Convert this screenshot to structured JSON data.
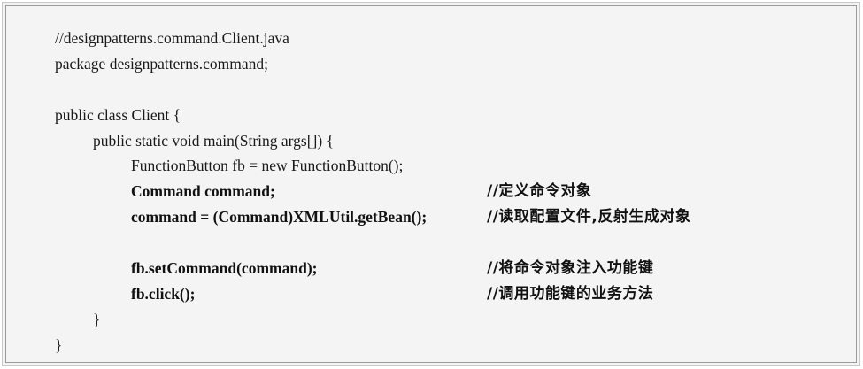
{
  "code": {
    "lines": [
      {
        "text": "//designpatterns.command.Client.java",
        "comment": ""
      },
      {
        "text": "package designpatterns.command;",
        "comment": ""
      },
      {
        "text": "",
        "comment": ""
      },
      {
        "text": "public class Client {",
        "comment": ""
      },
      {
        "text": "public static void main(String args[]) {",
        "comment": ""
      },
      {
        "text": "FunctionButton fb = new FunctionButton();",
        "comment": ""
      },
      {
        "text": "Command command;",
        "comment": "//定义命令对象"
      },
      {
        "text": "command = (Command)XMLUtil.getBean();",
        "comment": "//读取配置文件,反射生成对象"
      },
      {
        "text": "",
        "comment": ""
      },
      {
        "text": "fb.setCommand(command);",
        "comment": "//将命令对象注入功能键"
      },
      {
        "text": "fb.click();",
        "comment": "//调用功能键的业务方法"
      },
      {
        "text": "}",
        "comment": ""
      },
      {
        "text": "}",
        "comment": ""
      }
    ]
  }
}
